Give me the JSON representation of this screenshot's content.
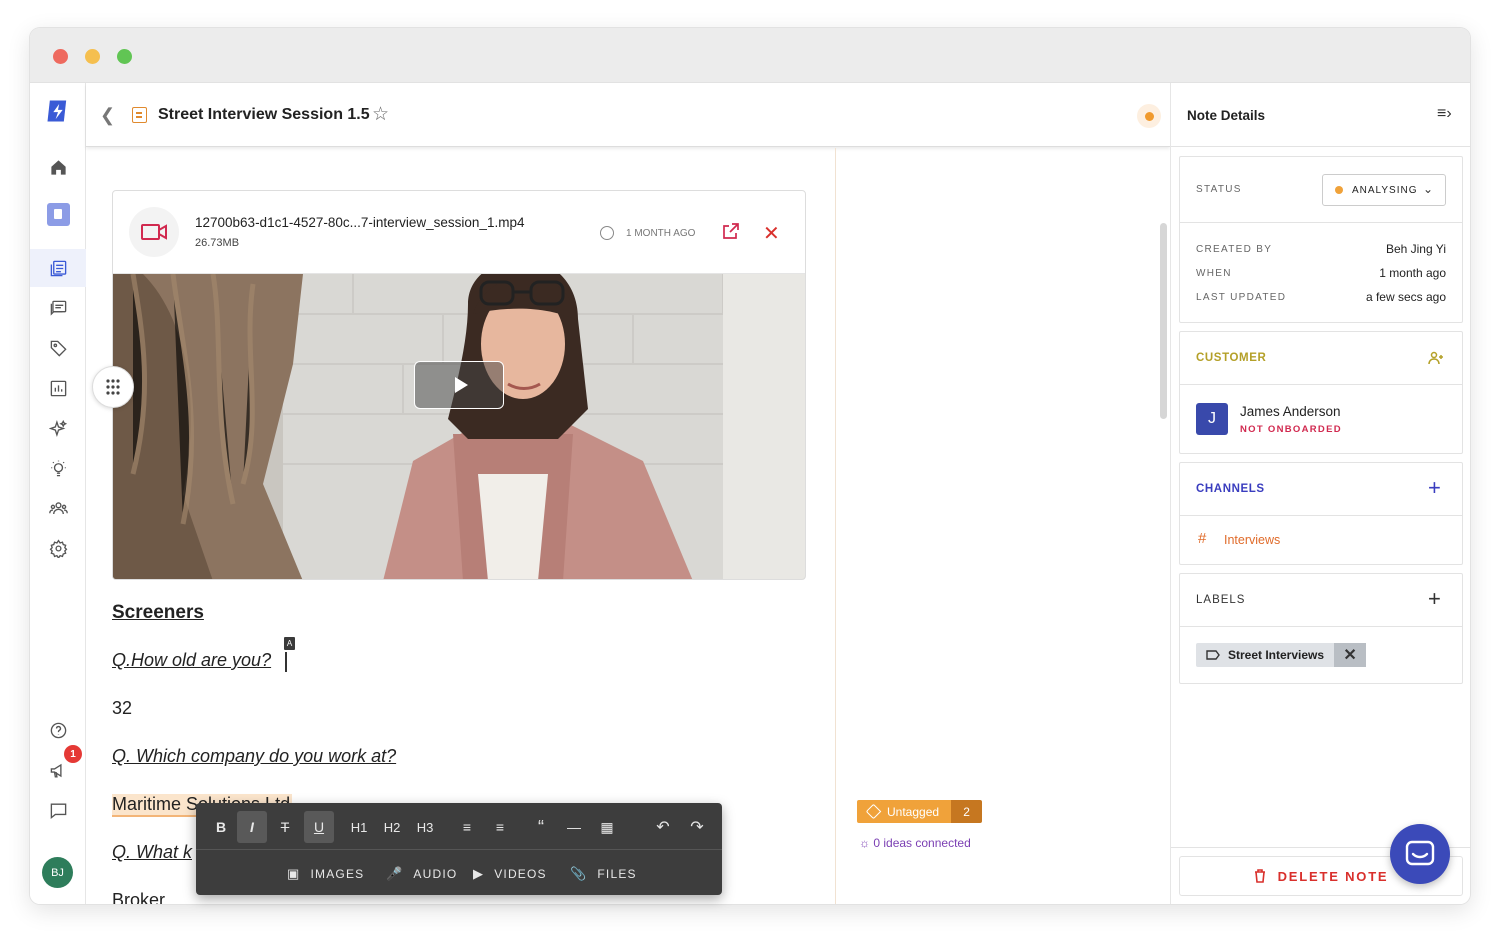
{
  "window": {
    "controls": [
      "close",
      "minimize",
      "maximize"
    ]
  },
  "header": {
    "title": "Street Interview Session 1.5"
  },
  "sidebar": {
    "items": [
      "home-icon",
      "notebook-icon",
      "notes-icon",
      "feedback-icon",
      "tag-icon",
      "analytics-icon",
      "sparkle-icon",
      "idea-icon",
      "customers-icon",
      "settings-icon"
    ],
    "bottom": [
      "help-icon",
      "announcement-icon",
      "chat-icon"
    ],
    "announcement_badge": "1",
    "user_initials": "BJ"
  },
  "media": {
    "filename": "12700b63-d1c1-4527-80c...7-interview_session_1.mp4",
    "size": "26.73MB",
    "time": "1 MONTH AGO"
  },
  "content": {
    "heading": "Screeners",
    "q1": "Q.How old are you? ",
    "a1": "32",
    "q2": "Q. Which company do you work at?",
    "a2": "Maritime Solutions Ltd",
    "q3": "Q. What k",
    "a3": "Broker",
    "cursor_tag": "A"
  },
  "toolbar": {
    "row1": [
      "B",
      "I",
      "S",
      "U",
      "H1",
      "H2",
      "H3",
      "bullets",
      "numbered",
      "quote",
      "rule",
      "table",
      "undo",
      "redo"
    ],
    "attachments": {
      "images": "IMAGES",
      "audio": "AUDIO",
      "videos": "VIDEOS",
      "files": "FILES"
    }
  },
  "tags": {
    "untagged": "Untagged",
    "count": "2",
    "ideas": "0 ideas connected"
  },
  "panel": {
    "title": "Note Details",
    "status_label": "STATUS",
    "status_value": "ANALYSING",
    "status_color": "#f0a23a",
    "created_by_label": "CREATED BY",
    "created_by": "Beh Jing Yi",
    "when_label": "WHEN",
    "when": "1 month ago",
    "updated_label": "LAST UPDATED",
    "updated": "a few secs ago",
    "customer_title": "CUSTOMER",
    "customer_initial": "J",
    "customer_name": "James Anderson",
    "customer_status": "NOT ONBOARDED",
    "channels_title": "CHANNELS",
    "channel": "Interviews",
    "labels_title": "LABELS",
    "label": "Street Interviews",
    "delete": "DELETE NOTE"
  }
}
